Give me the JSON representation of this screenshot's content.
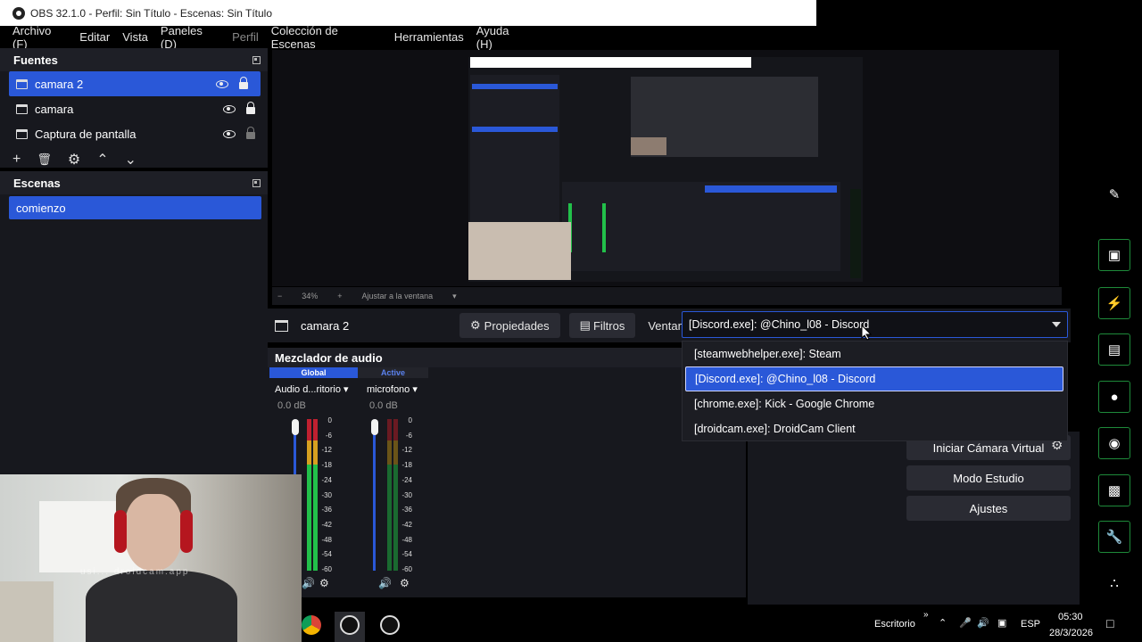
{
  "window": {
    "title": "OBS 32.1.0 - Perfil: Sin Título - Escenas: Sin Título"
  },
  "menu": [
    {
      "label": "Archivo (F)"
    },
    {
      "label": "Editar"
    },
    {
      "label": "Vista"
    },
    {
      "label": "Paneles (D)"
    },
    {
      "label": "Perfil"
    },
    {
      "label": "Colección de Escenas"
    },
    {
      "label": "Herramientas"
    },
    {
      "label": "Ayuda (H)"
    }
  ],
  "fuentes": {
    "title": "Fuentes",
    "items": [
      {
        "label": "camara 2",
        "selected": true,
        "locked": true
      },
      {
        "label": "camara",
        "selected": false,
        "locked": true
      },
      {
        "label": "Captura de pantalla",
        "selected": false,
        "locked": false
      }
    ],
    "toolbar_icons": [
      "add-icon",
      "trash-icon",
      "gear-icon",
      "chevron-up-icon",
      "chevron-down-icon"
    ]
  },
  "escenas": {
    "title": "Escenas",
    "items": [
      {
        "label": "comienzo",
        "selected": true
      }
    ]
  },
  "preview": {
    "zoom": "34%",
    "fit_label": "Ajustar a la ventana"
  },
  "properties": {
    "source_name": "camara 2",
    "propiedades_label": "Propiedades",
    "filtros_label": "Filtros",
    "ventana_label": "Ventana",
    "ventana_value": "[Discord.exe]: @Chino_l08 - Discord",
    "options": [
      {
        "label": "[steamwebhelper.exe]: Steam",
        "selected": false
      },
      {
        "label": "[Discord.exe]: @Chino_l08 - Discord",
        "selected": true
      },
      {
        "label": "[chrome.exe]: Kick - Google Chrome",
        "selected": false
      },
      {
        "label": "[droidcam.exe]: DroidCam Client",
        "selected": false
      }
    ]
  },
  "mixer": {
    "title": "Mezclador de audio",
    "tabs": [
      "Global",
      "Active"
    ],
    "channels": [
      {
        "name": "Audio d...ritorio",
        "db": "0.0 dB"
      },
      {
        "name": "microfono",
        "db": "0.0 dB"
      }
    ],
    "scale": [
      "0",
      "-6",
      "-12",
      "-18",
      "-24",
      "-30",
      "-36",
      "-42",
      "-48",
      "-54",
      "-60"
    ]
  },
  "controls": {
    "virtual_cam": "Iniciar Cámara Virtual",
    "studio_mode": "Modo Estudio",
    "settings": "Ajustes"
  },
  "sidebar_icons": [
    "edit-icon",
    "screenshot-icon",
    "lightning-icon",
    "document-icon",
    "chat-icon",
    "broadcast-icon",
    "scenes-icon",
    "wrench-icon",
    "more-icon"
  ],
  "webcam": {
    "watermark": "usi... droidcam.app"
  },
  "taskbar": {
    "escritorio": "Escritorio",
    "lang": "ESP",
    "time": "05:30",
    "date": "28/3/2026"
  },
  "colors": {
    "accent": "#2a58d8",
    "panel": "#17181e",
    "sidebar_border": "#1e8a3a"
  }
}
